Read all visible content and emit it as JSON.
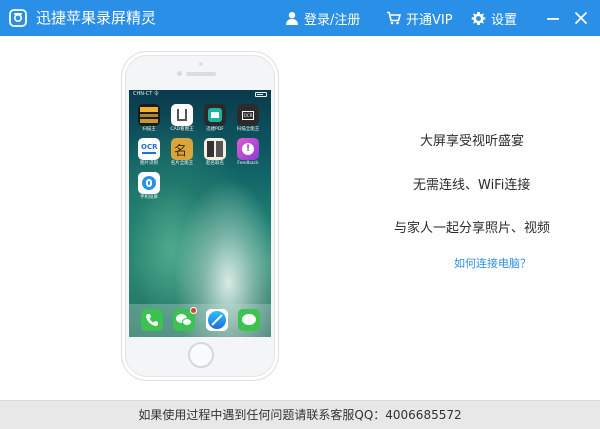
{
  "app": {
    "title": "迅捷苹果录屏精灵",
    "accent": "#2a8fe6"
  },
  "toolbar": {
    "login_label": "登录/注册",
    "vip_label": "开通VIP",
    "settings_label": "设置",
    "icons": [
      "user-icon",
      "cart-icon",
      "gear-icon",
      "minimize-icon",
      "close-icon"
    ]
  },
  "phone": {
    "status": {
      "carrier": "CHN-CT 令",
      "time": ""
    },
    "apps": [
      {
        "name": "扫描王",
        "color": "#f0b52a"
      },
      {
        "name": "CAD看图王",
        "color": "#ffffff"
      },
      {
        "name": "迅捷PDF",
        "color": "#1d9bd1"
      },
      {
        "name": "扫描全能王",
        "color": "#3a3a3a"
      },
      {
        "name": "图片识别",
        "color": "#ffffff"
      },
      {
        "name": "名片全能王",
        "color": "#d8a63a"
      },
      {
        "name": "起名取名",
        "color": "#f5efe0"
      },
      {
        "name": "Feedback",
        "color": "#c83bd6"
      },
      {
        "name": "手机投屏",
        "color": "#ffffff"
      }
    ],
    "dock": [
      "电话",
      "微信",
      "Safari",
      "信息"
    ]
  },
  "features": {
    "line1": "大屏享受视听盛宴",
    "line2": "无需连线、WiFi连接",
    "line3": "与家人一起分享照片、视频"
  },
  "help_link": "如何连接电脑？",
  "footer": "如果使用过程中遇到任何问题请联系客服QQ：4006685572"
}
